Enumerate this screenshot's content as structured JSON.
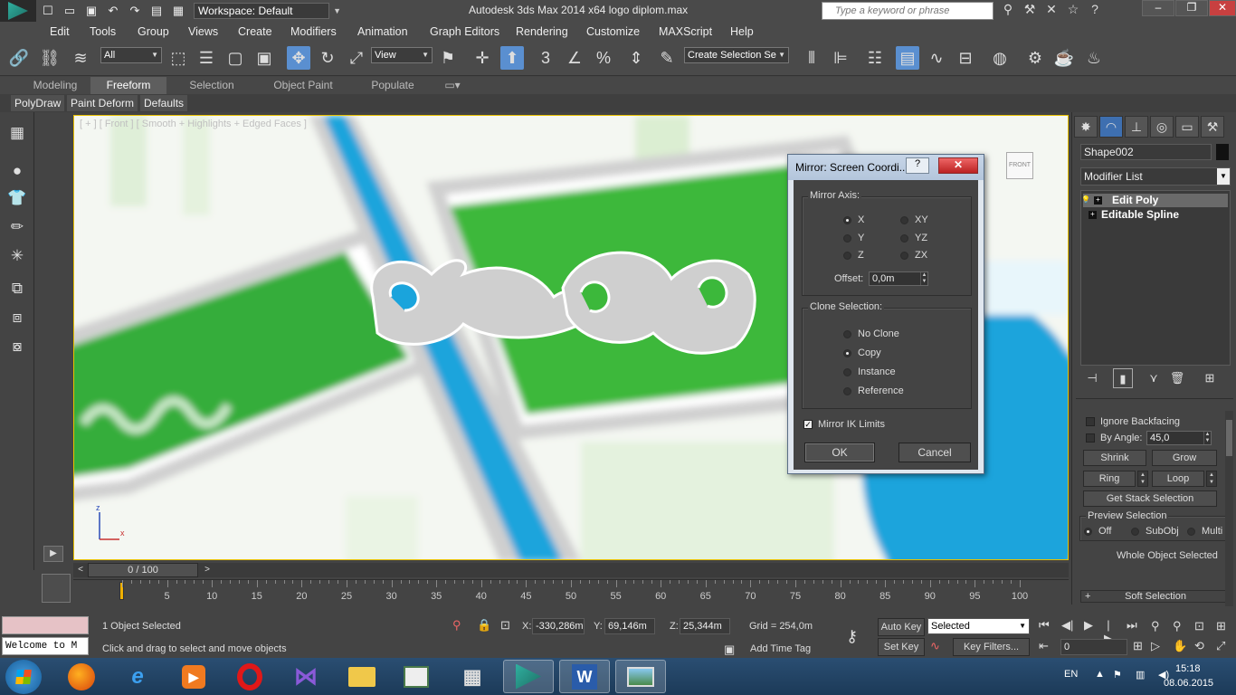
{
  "window": {
    "title": "Autodesk 3ds Max  2014 x64      logo diplom.max",
    "workspace_label": "Workspace: Default",
    "search_placeholder": "Type a keyword or phrase"
  },
  "menu": [
    "Edit",
    "Tools",
    "Group",
    "Views",
    "Create",
    "Modifiers",
    "Animation",
    "Graph Editors",
    "Rendering",
    "Customize",
    "MAXScript",
    "Help"
  ],
  "toolbar": {
    "filter_value": "All",
    "coord_value": "View",
    "selection_set_placeholder": "Create Selection Se",
    "snap_value": "3"
  },
  "ribbon": {
    "tabs": [
      "Modeling",
      "Freeform",
      "Selection",
      "Object Paint",
      "Populate"
    ],
    "active_tab": "Freeform",
    "subtabs": [
      "PolyDraw",
      "Paint Deform",
      "Defaults"
    ]
  },
  "viewport": {
    "label": "[ + ] [ Front ] [ Smooth + Highlights + Edged Faces ]",
    "viewcube_label": "FRONT",
    "axis_z": "z",
    "axis_x": "x"
  },
  "dialog": {
    "title": "Mirror: Screen Coordi...",
    "help": "?",
    "close": "✕",
    "mirror_axis_label": "Mirror Axis:",
    "axes": [
      "X",
      "Y",
      "Z",
      "XY",
      "YZ",
      "ZX"
    ],
    "selected_axis": "X",
    "offset_label": "Offset:",
    "offset_value": "0,0m",
    "clone_label": "Clone Selection:",
    "clone_options": [
      "No Clone",
      "Copy",
      "Instance",
      "Reference"
    ],
    "selected_clone": "Copy",
    "mirror_ik_label": "Mirror IK Limits",
    "mirror_ik_checked": true,
    "ok": "OK",
    "cancel": "Cancel"
  },
  "command_panel": {
    "object_name": "Shape002",
    "modifier_list_label": "Modifier List",
    "stack": [
      "Edit Poly",
      "Editable Spline"
    ],
    "ignore_backfacing": "Ignore Backfacing",
    "by_angle_label": "By Angle:",
    "by_angle_value": "45,0",
    "shrink": "Shrink",
    "grow": "Grow",
    "ring": "Ring",
    "loop": "Loop",
    "get_stack_selection": "Get Stack Selection",
    "preview_selection_label": "Preview Selection",
    "preview_options": [
      "Off",
      "SubObj",
      "Multi"
    ],
    "preview_selected": "Off",
    "whole_object_selected": "Whole Object Selected",
    "soft_selection": "Soft Selection"
  },
  "timeline": {
    "slider_label": "0 / 100",
    "ticks": [
      5,
      10,
      15,
      20,
      25,
      30,
      35,
      40,
      45,
      50,
      55,
      60,
      65,
      70,
      75,
      80,
      85,
      90,
      95,
      100
    ]
  },
  "status": {
    "listener_text": "Welcome to M",
    "objects_selected": "1 Object Selected",
    "prompt": "Click and drag to select and move objects",
    "x_label": "X:",
    "x_value": "-330,286m",
    "y_label": "Y:",
    "y_value": "69,146m",
    "z_label": "Z:",
    "z_value": "25,344m",
    "grid": "Grid = 254,0m",
    "add_time_tag": "Add Time Tag",
    "auto_key": "Auto Key",
    "set_key": "Set Key",
    "key_selected": "Selected",
    "key_filters": "Key Filters...",
    "frame_value": "0"
  },
  "taskbar": {
    "lang": "EN",
    "time": "15:18",
    "date": "08.06.2015"
  },
  "colors": {
    "viewport_green": "#3db53a",
    "viewport_blue": "#1aa8e0",
    "dialog_frame": "#dfe6ee",
    "panel_bg": "#444444"
  }
}
